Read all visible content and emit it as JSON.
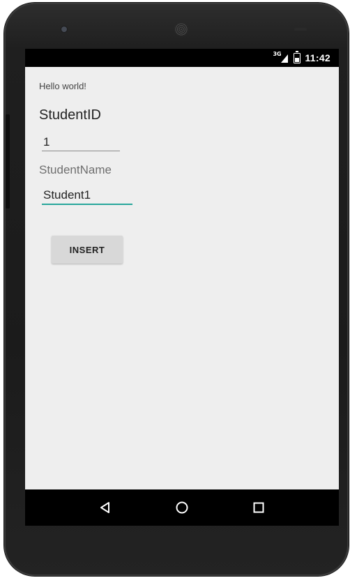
{
  "status_bar": {
    "network_type": "3G",
    "time": "11:42"
  },
  "main": {
    "hello_text": "Hello world!",
    "student_id_label": "StudentID",
    "student_id_value": "1",
    "student_name_label": "StudentName",
    "student_name_value": "Student1",
    "insert_button_label": "INSERT"
  },
  "nav_bar": {
    "back_icon": "back-triangle-icon",
    "home_icon": "home-circle-icon",
    "recents_icon": "recents-square-icon"
  },
  "colors": {
    "accent": "#26a69a",
    "screen_background": "#eeeeee",
    "button_background": "#d8d8d8"
  }
}
